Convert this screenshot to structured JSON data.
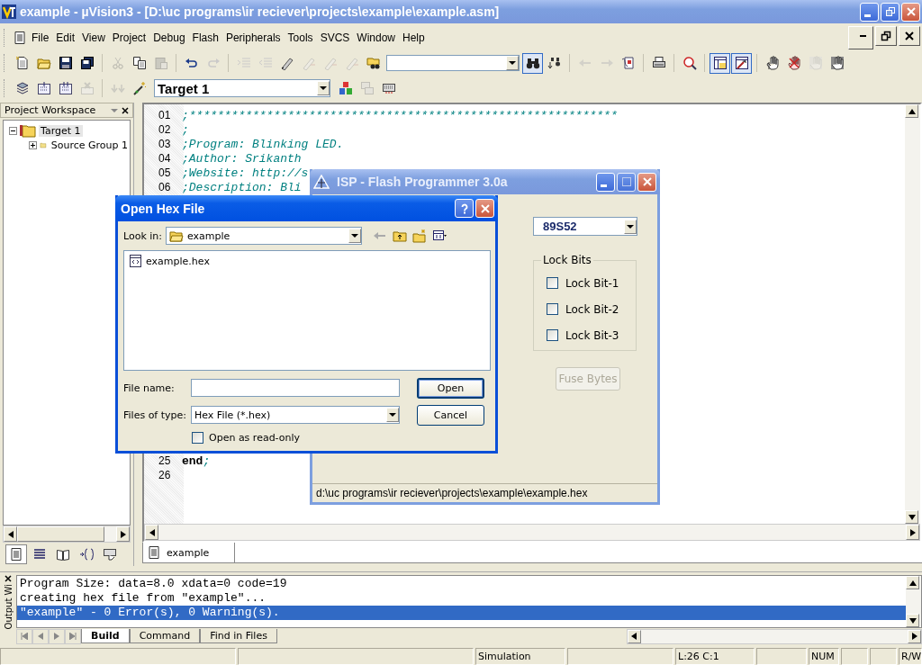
{
  "window": {
    "title": "example  - µVision3 - [D:\\uc programs\\ir reciever\\projects\\example\\example.asm]"
  },
  "menu": [
    "File",
    "Edit",
    "View",
    "Project",
    "Debug",
    "Flash",
    "Peripherals",
    "Tools",
    "SVCS",
    "Window",
    "Help"
  ],
  "toolbar_1": [
    {
      "kind": "button",
      "pressed": false,
      "disabled": false
    },
    {
      "kind": "button",
      "pressed": false,
      "disabled": false
    },
    {
      "kind": "button",
      "pressed": false,
      "disabled": false
    },
    {
      "kind": "button",
      "pressed": false,
      "disabled": false
    },
    {
      "kind": "separator"
    },
    {
      "kind": "button",
      "pressed": false,
      "disabled": true
    },
    {
      "kind": "button",
      "pressed": false,
      "disabled": false
    },
    {
      "kind": "button",
      "pressed": false,
      "disabled": true
    },
    {
      "kind": "separator"
    },
    {
      "kind": "button",
      "pressed": false,
      "disabled": false
    },
    {
      "kind": "button",
      "pressed": false,
      "disabled": true
    },
    {
      "kind": "separator"
    },
    {
      "kind": "button",
      "pressed": false,
      "disabled": true
    },
    {
      "kind": "button",
      "pressed": false,
      "disabled": true
    },
    {
      "kind": "button",
      "pressed": false,
      "disabled": false
    },
    {
      "kind": "button",
      "pressed": false,
      "disabled": true
    },
    {
      "kind": "button",
      "pressed": false,
      "disabled": true
    },
    {
      "kind": "button",
      "pressed": false,
      "disabled": true
    },
    {
      "kind": "button",
      "pressed": false,
      "disabled": false
    },
    {
      "kind": "combo"
    },
    {
      "kind": "button",
      "pressed": true,
      "disabled": false
    },
    {
      "kind": "button",
      "pressed": false,
      "disabled": false
    },
    {
      "kind": "separator"
    },
    {
      "kind": "button",
      "pressed": false,
      "disabled": true
    },
    {
      "kind": "button",
      "pressed": false,
      "disabled": true
    },
    {
      "kind": "button",
      "pressed": false,
      "disabled": false
    },
    {
      "kind": "separator"
    },
    {
      "kind": "button",
      "pressed": false,
      "disabled": false
    },
    {
      "kind": "separator"
    },
    {
      "kind": "button",
      "pressed": false,
      "disabled": false
    },
    {
      "kind": "separator"
    },
    {
      "kind": "button",
      "pressed": true,
      "disabled": false
    },
    {
      "kind": "button",
      "pressed": true,
      "disabled": false
    },
    {
      "kind": "separator"
    },
    {
      "kind": "button",
      "pressed": false,
      "disabled": false
    },
    {
      "kind": "button",
      "pressed": false,
      "disabled": false
    },
    {
      "kind": "button",
      "pressed": false,
      "disabled": true
    },
    {
      "kind": "button",
      "pressed": false,
      "disabled": false
    }
  ],
  "toolbar_2": {
    "buttons": [
      {
        "pressed": false,
        "disabled": false
      },
      {
        "pressed": false,
        "disabled": false
      },
      {
        "pressed": false,
        "disabled": false
      },
      {
        "pressed": false,
        "disabled": true
      },
      {
        "pressed": false,
        "disabled": true
      },
      {
        "pressed": false,
        "disabled": false
      }
    ],
    "target": "Target 1",
    "buttons_after": [
      {
        "pressed": false,
        "disabled": false
      },
      {
        "pressed": false,
        "disabled": true
      },
      {
        "pressed": false,
        "disabled": false
      }
    ]
  },
  "workspace": {
    "title": "Project Workspace",
    "tree": [
      {
        "label": "Target 1",
        "expanded": true,
        "selected": true,
        "children": [
          {
            "label": "Source Group 1",
            "expanded": false,
            "selected": false
          }
        ]
      }
    ],
    "tabs": [
      {
        "selected": true
      },
      {
        "selected": false
      },
      {
        "selected": false
      },
      {
        "selected": false
      },
      {
        "selected": false
      }
    ]
  },
  "editor": {
    "lines": [
      {
        "number": "01",
        "comment": ";*************************************************************"
      },
      {
        "number": "02",
        "comment": ";"
      },
      {
        "number": "03",
        "comment": ";Program: Blinking LED."
      },
      {
        "number": "04",
        "comment": ";Author: Srikanth"
      },
      {
        "number": "05",
        "comment": ";Website: http://s"
      },
      {
        "number": "06",
        "comment": ";Description: Bli"
      },
      {
        "number": "25",
        "code": "end",
        "comment": ";"
      },
      {
        "number": "26"
      }
    ],
    "tabs": [
      {
        "label": "example",
        "selected": true
      }
    ]
  },
  "isp_window": {
    "title": "ISP - Flash Programmer  3.0a",
    "device": "89S52",
    "lock_bits": {
      "title": "Lock Bits",
      "items": [
        {
          "label": "Lock Bit-1",
          "checked": false
        },
        {
          "label": "Lock Bit-2",
          "checked": false
        },
        {
          "label": "Lock Bit-3",
          "checked": false
        }
      ]
    },
    "fuse_button": {
      "label": "Fuse Bytes",
      "disabled": true
    },
    "status": "d:\\uc programs\\ir reciever\\projects\\example\\example.hex"
  },
  "open_dialog": {
    "title": "Open Hex File",
    "look_in_label": "Look in:",
    "look_in": "example",
    "files": [
      {
        "name": "example.hex",
        "selected": false
      }
    ],
    "file_name_label": "File name:",
    "file_type_label": "Files of type:",
    "file_type": "Hex File (*.hex)",
    "read_only": {
      "label": "Open as read-only",
      "checked": false
    },
    "buttons": [
      {
        "label": "Open",
        "default": true
      },
      {
        "label": "Cancel",
        "default": false
      }
    ]
  },
  "output": {
    "side_label": "Output Wi",
    "lines": [
      {
        "text": "Program Size: data=8.0 xdata=0 code=19",
        "selected": false
      },
      {
        "text": "creating hex file from \"example\"...",
        "selected": false
      },
      {
        "text": "\"example\" - 0 Error(s), 0 Warning(s).",
        "selected": true
      }
    ],
    "tabs": [
      {
        "label": "Build",
        "selected": true
      },
      {
        "label": "Command",
        "selected": false
      },
      {
        "label": "Find in Files",
        "selected": false
      }
    ]
  },
  "status_bar": [
    {
      "kind": "blank"
    },
    {
      "kind": "blank"
    },
    {
      "kind": "text",
      "text": "Simulation"
    },
    {
      "kind": "blank"
    },
    {
      "kind": "text",
      "text": "L:26 C:1"
    },
    {
      "kind": "blank"
    },
    {
      "kind": "text",
      "text": "NUM"
    },
    {
      "kind": "blank"
    },
    {
      "kind": "blank"
    },
    {
      "kind": "text",
      "text": "R/W"
    }
  ]
}
